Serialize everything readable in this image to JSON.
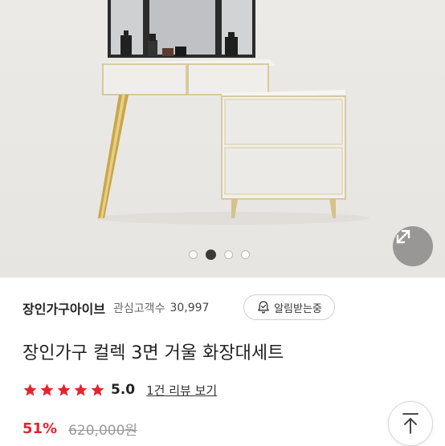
{
  "product_image": {
    "alt": "",
    "carousel": {
      "total": 4,
      "active_index": 1
    }
  },
  "seller": {
    "name": "장인가구아이브",
    "interest_label": "관심고객수",
    "interest_count": "30,997",
    "alarm_label": "알림받는중"
  },
  "product": {
    "title": "장인가구 컬렉 3면 거울 화장대세트",
    "rating": {
      "stars": 5,
      "score": "5.0",
      "review_link": "1건 리뷰 보기"
    },
    "price": {
      "discount": "51%",
      "original": "620,000원"
    }
  },
  "colors": {
    "discount_red": "#e0262f",
    "star_red": "#e0262f",
    "expand_button_bg": "#787878"
  },
  "icons": {
    "expand": "expand-arrows-icon",
    "alarm": "bell-check-icon",
    "star": "star-icon",
    "scroll_top": "arrow-up-icon"
  }
}
